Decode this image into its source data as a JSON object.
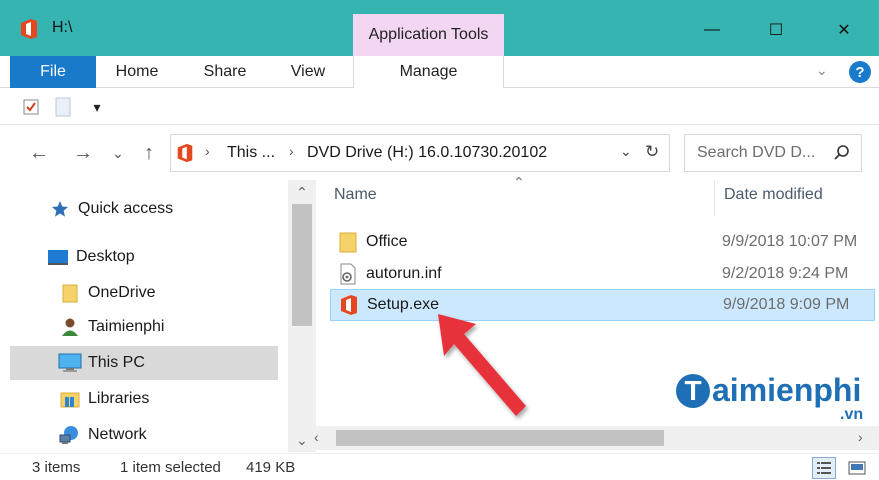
{
  "window": {
    "title": "H:\\",
    "contextual_tab_group": "Application Tools",
    "controls": {
      "minimize": "—",
      "maximize": "☐",
      "close": "✕"
    }
  },
  "ribbon": {
    "tabs": [
      "File",
      "Home",
      "Share",
      "View",
      "Manage"
    ],
    "expand_chevron": "⌄",
    "help": "?"
  },
  "qat": {
    "dropdown": "▾"
  },
  "address": {
    "crumbs": [
      "This ...",
      "DVD Drive (H:) 16.0.10730.20102"
    ],
    "separator": "›",
    "dropdown": "⌄",
    "refresh": "↻"
  },
  "search": {
    "placeholder": "Search DVD D..."
  },
  "nav_buttons": {
    "back": "←",
    "forward": "→",
    "recent": "⌄",
    "up": "↑"
  },
  "nav_pane": {
    "items": [
      {
        "label": "Quick access",
        "icon": "star-icon"
      },
      {
        "label": "Desktop",
        "icon": "desktop-icon"
      },
      {
        "label": "OneDrive",
        "icon": "folder-icon"
      },
      {
        "label": "Taimienphi",
        "icon": "user-icon"
      },
      {
        "label": "This PC",
        "icon": "computer-icon",
        "selected": true
      },
      {
        "label": "Libraries",
        "icon": "libraries-icon"
      },
      {
        "label": "Network",
        "icon": "network-icon"
      }
    ]
  },
  "file_list": {
    "columns": {
      "name": "Name",
      "date": "Date modified"
    },
    "rows": [
      {
        "name": "Office",
        "date": "9/9/2018 10:07 PM",
        "icon": "folder-icon"
      },
      {
        "name": "autorun.inf",
        "date": "9/2/2018 9:24 PM",
        "icon": "settings-file-icon"
      },
      {
        "name": "Setup.exe",
        "date": "9/9/2018 9:09 PM",
        "icon": "office-logo-icon",
        "selected": true
      }
    ]
  },
  "watermark": {
    "main": "aimienphi",
    "letter": "T",
    "suffix": ".vn"
  },
  "status": {
    "items_count": "3 items",
    "selection": "1 item selected",
    "size": "419 KB"
  },
  "colors": {
    "titlebar": "#36b4b2",
    "file_tab": "#1979ca",
    "contextual_tab": "#f2d6f2",
    "selection_bg": "#cce8ff",
    "arrow": "#e8333b",
    "office_red": "#e6471e"
  }
}
